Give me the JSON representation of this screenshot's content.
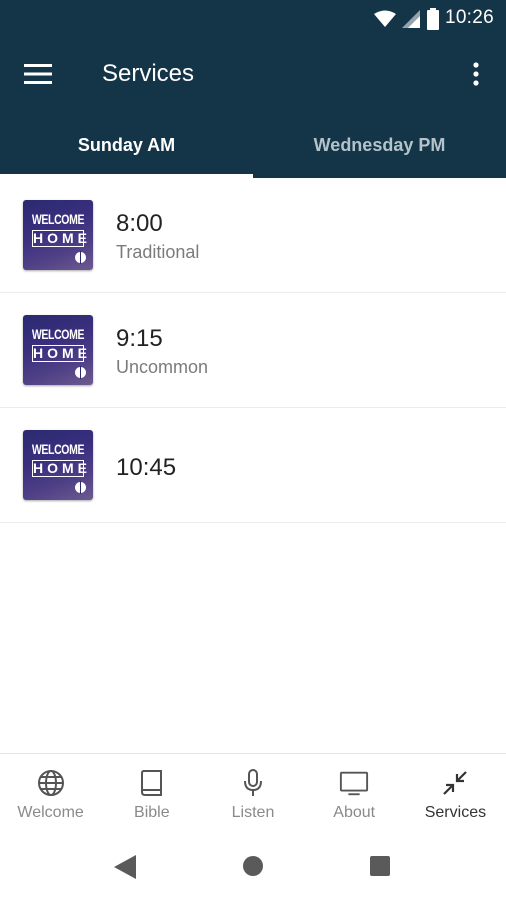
{
  "status_bar": {
    "time": "10:26"
  },
  "toolbar": {
    "title": "Services"
  },
  "tabs": [
    {
      "label": "Sunday AM",
      "active": true
    },
    {
      "label": "Wednesday PM",
      "active": false
    }
  ],
  "services": [
    {
      "time": "8:00",
      "name": "Traditional",
      "thumbnail": {
        "line1": "WELCOME",
        "line2": "HOME"
      }
    },
    {
      "time": "9:15",
      "name": "Uncommon",
      "thumbnail": {
        "line1": "WELCOME",
        "line2": "HOME"
      }
    },
    {
      "time": "10:45",
      "name": "",
      "thumbnail": {
        "line1": "WELCOME",
        "line2": "HOME"
      }
    }
  ],
  "bottom_nav": [
    {
      "label": "Welcome",
      "icon": "globe-icon",
      "active": false
    },
    {
      "label": "Bible",
      "icon": "book-icon",
      "active": false
    },
    {
      "label": "Listen",
      "icon": "microphone-icon",
      "active": false
    },
    {
      "label": "About",
      "icon": "monitor-icon",
      "active": false
    },
    {
      "label": "Services",
      "icon": "collapse-arrows-icon",
      "active": true
    }
  ],
  "colors": {
    "app_bar": "#143447",
    "tab_inactive": "#b4c2cb",
    "subtitle": "#7b7b7b"
  }
}
